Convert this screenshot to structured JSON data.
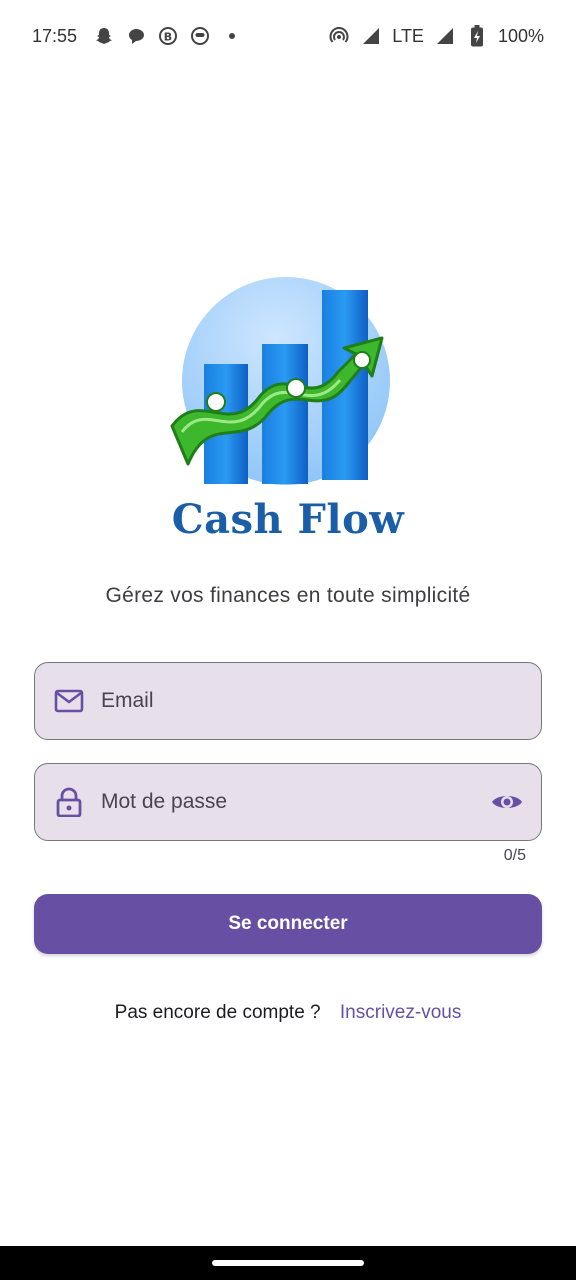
{
  "status_bar": {
    "time": "17:55",
    "network": "LTE",
    "battery": "100%",
    "icons": [
      "snapchat-icon",
      "chat-bubble-icon",
      "b-circle-icon",
      "robot-icon",
      "dot-icon",
      "hotspot-icon",
      "signal-icon",
      "battery-charging-icon"
    ]
  },
  "logo": {
    "app_name": "Cash Flow"
  },
  "tagline": "Gérez vos finances en toute simplicité",
  "form": {
    "email": {
      "placeholder": "Email",
      "value": "",
      "icon": "mail-icon"
    },
    "password": {
      "placeholder": "Mot de passe",
      "value": "",
      "icon": "lock-icon",
      "toggle_icon": "eye-icon",
      "counter": "0/5"
    },
    "login_label": "Se connecter"
  },
  "signup": {
    "text": "Pas encore de compte ?",
    "link": "Inscrivez-vous"
  },
  "colors": {
    "primary": "#6750a4",
    "field_bg": "#e7e0ea",
    "brand_blue": "#1a5ea8",
    "money_green": "#3db82c"
  }
}
